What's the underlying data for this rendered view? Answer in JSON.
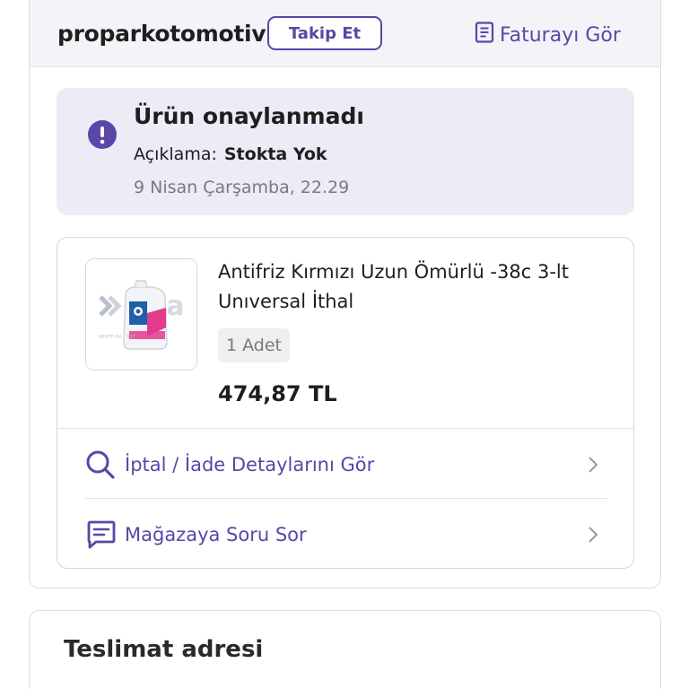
{
  "order": {
    "seller_name": "proparkotomotiv",
    "follow_label": "Takip Et",
    "invoice_label": "Faturayı Gör",
    "status": {
      "title": "Ürün onaylanmadı",
      "description_label": "Açıklama:",
      "description_value": "Stokta Yok",
      "date": "9 Nisan Çarşamba, 22.29"
    },
    "product": {
      "title": "Antifriz Kırmızı Uzun Ömürlü -38c 3-lt Unıversal İthal",
      "quantity": "1 Adet",
      "price": "474,87 TL",
      "image_brand_text": "kama"
    },
    "actions": {
      "return_details": "İptal / İade Detaylarını Gör",
      "ask_store": "Mağazaya Soru Sor"
    }
  },
  "delivery": {
    "title": "Teslimat adresi"
  },
  "colors": {
    "accent": "#5a46a8",
    "status_bg": "#ecebf6",
    "header_bg": "#f3f4f8",
    "muted_text": "#7a7a7a"
  },
  "icons": {
    "invoice": "document-icon",
    "status": "exclamation-circle-icon",
    "return": "search-icon",
    "ask": "chat-icon",
    "chevron": "chevron-right-icon"
  }
}
